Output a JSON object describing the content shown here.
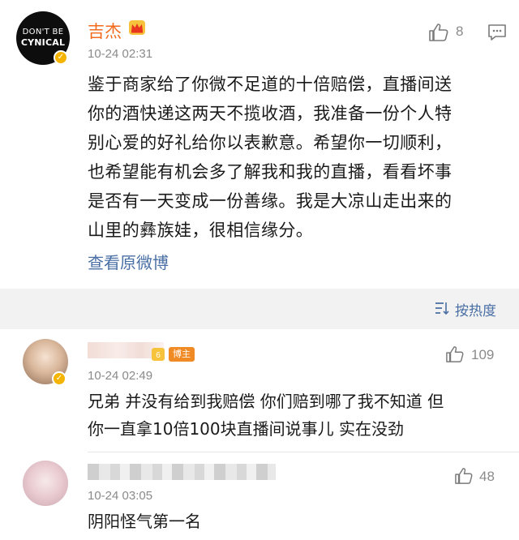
{
  "post": {
    "author_name": "吉杰",
    "avatar_text_line1": "DON'T BE",
    "avatar_text_line2": "CYNICAL",
    "time": "10-24 02:31",
    "like_count": "8",
    "body": "鉴于商家给了你微不足道的十倍赔偿，直播间送\n你的酒快递这两天不揽收酒，我准备一份个人特\n别心爱的好礼给你以表歉意。希望你一切顺利，\n也希望能有机会多了解我和我的直播，看看坏事\n是否有一天变成一份善缘。我是大凉山走出来的\n山里的彝族娃，很相信缘分。",
    "view_original_label": "查看原微博",
    "icons": {
      "verified": "verified-badge-icon",
      "crown": "crown-icon",
      "like": "thumbs-up-icon",
      "comment": "comment-icon"
    },
    "colors": {
      "name": "#f26b1d",
      "link": "#4a6fa5",
      "meta": "#8a8a8a",
      "verified": "#f5b400"
    }
  },
  "sort": {
    "label": "按热度",
    "icon": "sort-icon"
  },
  "comments": [
    {
      "badge_label": "博主",
      "time": "10-24 02:49",
      "like_count": "109",
      "text": "兄弟 并没有给到我赔偿 你们赔到哪了我不知道 但\n你一直拿10倍100块直播间说事儿 实在没劲"
    },
    {
      "time": "10-24 03:05",
      "like_count": "48",
      "text": "阴阳怪气第一名"
    }
  ]
}
